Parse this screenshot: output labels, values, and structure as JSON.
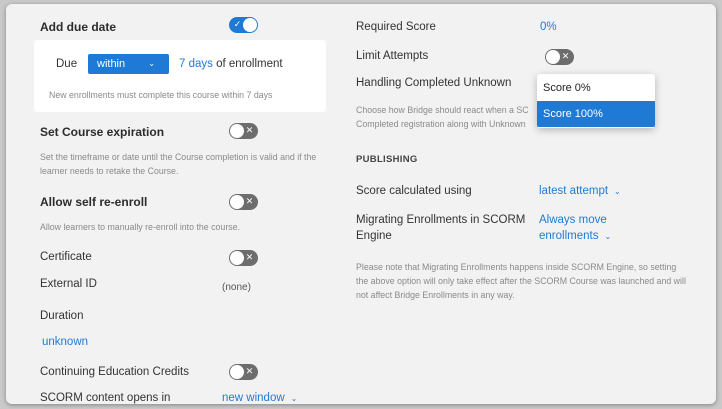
{
  "left": {
    "due_date": {
      "title": "Add due date",
      "toggle_on": true,
      "due_label": "Due",
      "select_value": "within",
      "days_link": "7 days",
      "of_enrollment": "of enrollment",
      "help": "New enrollments must complete this course within 7 days"
    },
    "expiration": {
      "title": "Set Course expiration",
      "toggle_on": false,
      "help": "Set the timeframe or date until the Course completion is valid and if the learner needs to retake the Course."
    },
    "self_reenroll": {
      "title": "Allow self re-enroll",
      "toggle_on": false,
      "help": "Allow learners to manually re-enroll into the course."
    },
    "certificate": {
      "label": "Certificate",
      "toggle_on": false
    },
    "external_id": {
      "label": "External ID",
      "value": "(none)"
    },
    "duration": {
      "label": "Duration",
      "value": "unknown"
    },
    "ce_credits": {
      "label": "Continuing Education Credits",
      "toggle_on": false
    },
    "scorm_opens": {
      "label": "SCORM content opens in",
      "value": "new window"
    }
  },
  "right": {
    "required_score": {
      "label": "Required Score",
      "value": "0%"
    },
    "limit_attempts": {
      "label": "Limit Attempts",
      "toggle_on": false
    },
    "handling": {
      "label": "Handling Completed Unknown",
      "help_line1": "Choose how Bridge should react when a SC",
      "help_line2": "Completed registration along with Unknown"
    },
    "dropdown": {
      "options": [
        "Score 0%",
        "Score 100%"
      ],
      "selected_index": 1
    },
    "publishing": {
      "heading": "PUBLISHING",
      "score_calc_label": "Score calculated using",
      "score_calc_value": "latest attempt",
      "migrating_label_1": "Migrating Enrollments in SCORM",
      "migrating_label_2": "Engine",
      "migrating_value_1": "Always move",
      "migrating_value_2": "enrollments",
      "note": "Please note that Migrating Enrollments happens inside SCORM Engine, so setting the above option will only take effect after the SCORM Course was launched and will not affect Bridge Enrollments in any way."
    }
  },
  "colors": {
    "accent": "#1f7ad6",
    "toggle_off": "#6d6d6d",
    "panel_bg": "#f2f2f2"
  }
}
